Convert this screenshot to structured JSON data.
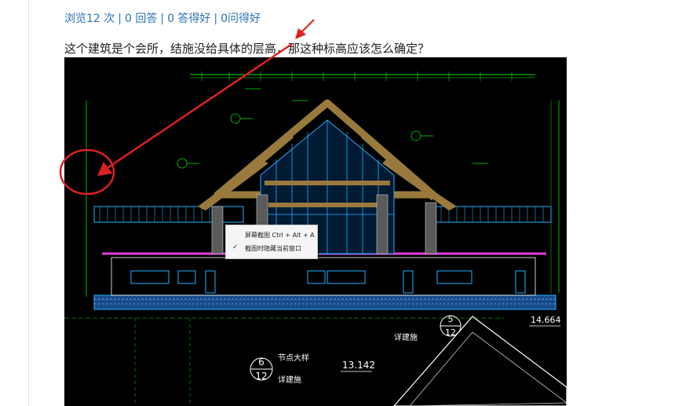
{
  "stats": {
    "views": "浏览12 次",
    "answers": "0 回答",
    "good_answers": "0 答得好",
    "good_questions": "0问得好",
    "sep": "|"
  },
  "question": {
    "text": "这个建筑是个会所，结施没给具体的层高，那这种标高应该怎么确定？"
  },
  "context_menu": {
    "item1": "屏幕截图 Ctrl + Alt + A",
    "item2": "截图时隐藏当前窗口",
    "check_glyph": "✓"
  },
  "drawing": {
    "detail_a_top": "5",
    "detail_a_bottom": "12",
    "detail_a_label": "详建施",
    "detail_b_top": "6",
    "detail_b_bottom": "12",
    "detail_b_title": "节点大样",
    "detail_b_label": "详建施",
    "elev_1": "13.142",
    "elev_2": "14.664"
  },
  "colors": {
    "link": "#2a72b5",
    "annotation": "#e02020",
    "cad_bg": "#000000",
    "cad_green": "#00e000",
    "cad_cyan": "#1fb0ff",
    "cad_wood": "#9a7a3c",
    "cad_magenta": "#e040e0"
  }
}
